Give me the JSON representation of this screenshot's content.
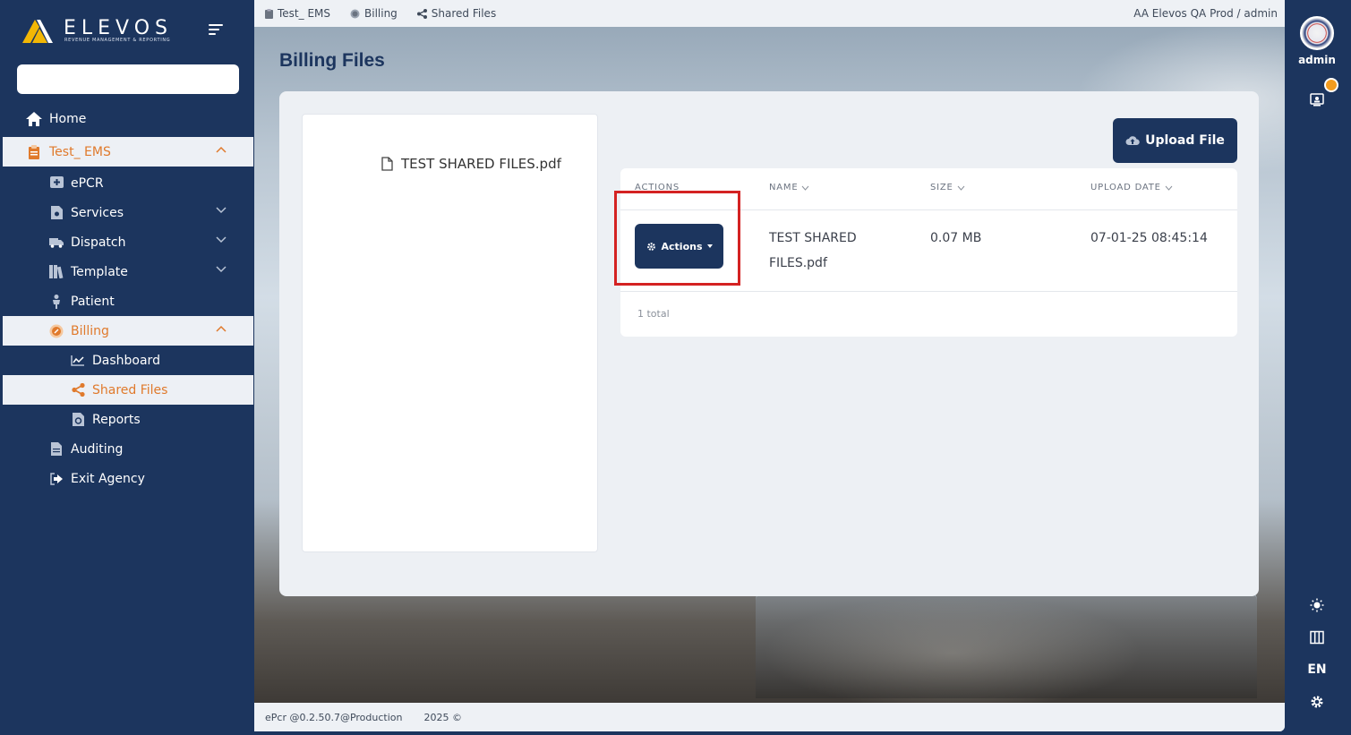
{
  "brand": {
    "name": "ELEVOS",
    "tagline": "REVENUE MANAGEMENT & REPORTING"
  },
  "sidebar": {
    "search_placeholder": "",
    "items": [
      {
        "label": "Home"
      },
      {
        "label": "Test_ EMS"
      },
      {
        "label": "ePCR"
      },
      {
        "label": "Services"
      },
      {
        "label": "Dispatch"
      },
      {
        "label": "Template"
      },
      {
        "label": "Patient"
      },
      {
        "label": "Billing"
      },
      {
        "label": "Dashboard"
      },
      {
        "label": "Shared Files"
      },
      {
        "label": "Reports"
      },
      {
        "label": "Auditing"
      },
      {
        "label": "Exit Agency"
      }
    ]
  },
  "breadcrumb": [
    "Test_ EMS",
    "Billing",
    "Shared Files"
  ],
  "agency_user": "AA Elevos QA Prod / admin",
  "page": {
    "title": "Billing Files",
    "file_list": [
      "TEST SHARED FILES.pdf"
    ],
    "upload_button": "Upload File",
    "table": {
      "columns": [
        "ACTIONS",
        "NAME",
        "SIZE",
        "UPLOAD DATE"
      ],
      "rows": [
        {
          "actions": "Actions",
          "name_line1": "TEST SHARED",
          "name_line2": "FILES.pdf",
          "size": "0.07 MB",
          "upload_date": "07-01-25 08:45:14"
        }
      ],
      "total": "1 total"
    }
  },
  "footer": {
    "version": "ePcr @0.2.50.7@Production",
    "copyright": "2025 ©"
  },
  "rail": {
    "user": "admin",
    "language": "EN"
  },
  "colors": {
    "navy": "#1c355e",
    "accent": "#e07a2c",
    "highlight": "#d42222"
  }
}
